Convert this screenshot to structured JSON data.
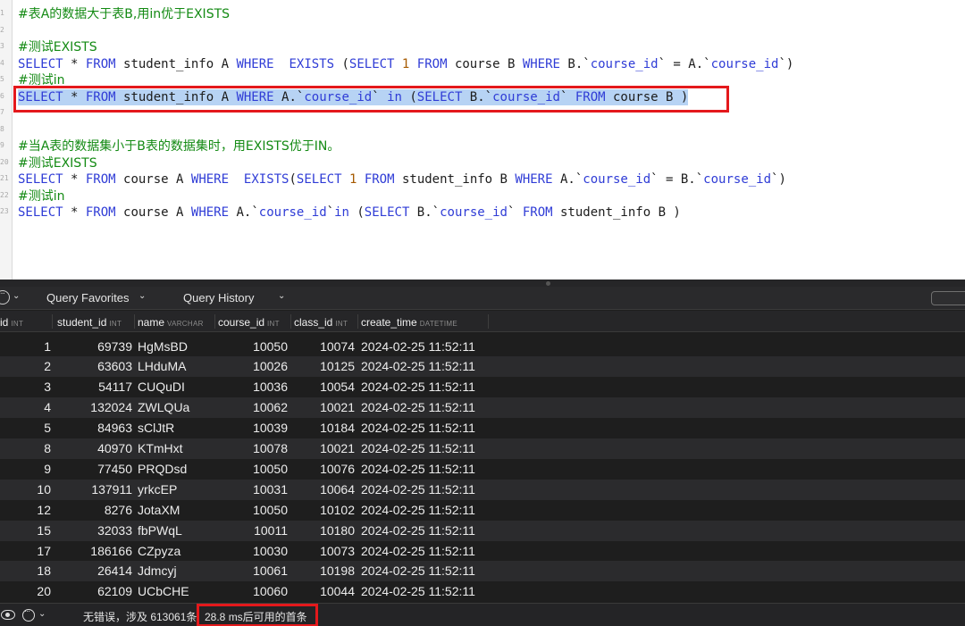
{
  "editor": {
    "lines": [
      {
        "n": "1",
        "type": "comment",
        "text": "#表A的数据大于表B,用in优于EXISTS"
      },
      {
        "n": "2",
        "type": "blank",
        "text": ""
      },
      {
        "n": "3",
        "type": "comment",
        "text": "#测试EXISTS"
      },
      {
        "n": "4",
        "type": "code",
        "tokens": [
          [
            "kw",
            "SELECT"
          ],
          [
            "t",
            " * "
          ],
          [
            "kw",
            "FROM"
          ],
          [
            "t",
            " student_info A "
          ],
          [
            "kw",
            "WHERE"
          ],
          [
            "t",
            "  "
          ],
          [
            "kw",
            "EXISTS"
          ],
          [
            "t",
            " ("
          ],
          [
            "kw",
            "SELECT"
          ],
          [
            "t",
            " "
          ],
          [
            "num",
            "1"
          ],
          [
            "t",
            " "
          ],
          [
            "kw",
            "FROM"
          ],
          [
            "t",
            " course B "
          ],
          [
            "kw",
            "WHERE"
          ],
          [
            "t",
            " B."
          ],
          [
            "tick",
            "`"
          ],
          [
            "col",
            "course_id"
          ],
          [
            "tick",
            "`"
          ],
          [
            "t",
            " = A."
          ],
          [
            "tick",
            "`"
          ],
          [
            "col",
            "course_id"
          ],
          [
            "tick",
            "`"
          ],
          [
            "t",
            ")"
          ]
        ]
      },
      {
        "n": "5",
        "type": "comment",
        "text": "#测试in"
      },
      {
        "n": "6",
        "type": "code",
        "selected": true,
        "tokens": [
          [
            "kw",
            "SELECT"
          ],
          [
            "t",
            " * "
          ],
          [
            "kw",
            "FROM"
          ],
          [
            "t",
            " student_info A "
          ],
          [
            "kw",
            "WHERE"
          ],
          [
            "t",
            " A."
          ],
          [
            "tick",
            "`"
          ],
          [
            "col",
            "course_id"
          ],
          [
            "tick",
            "`"
          ],
          [
            "t",
            " "
          ],
          [
            "kw",
            "in"
          ],
          [
            "t",
            " ("
          ],
          [
            "kw",
            "SELECT"
          ],
          [
            "t",
            " B."
          ],
          [
            "tick",
            "`"
          ],
          [
            "col",
            "course_id"
          ],
          [
            "tick",
            "`"
          ],
          [
            "t",
            " "
          ],
          [
            "kw",
            "FROM"
          ],
          [
            "t",
            " course B )"
          ]
        ]
      },
      {
        "n": "7",
        "type": "blank",
        "text": ""
      },
      {
        "n": "8",
        "type": "blank",
        "text": ""
      },
      {
        "n": "9",
        "type": "comment",
        "text": "#当A表的数据集小于B表的数据集时，用EXISTS优于IN。"
      },
      {
        "n": "20",
        "type": "comment",
        "text": "#测试EXISTS"
      },
      {
        "n": "21",
        "type": "code",
        "tokens": [
          [
            "kw",
            "SELECT"
          ],
          [
            "t",
            " * "
          ],
          [
            "kw",
            "FROM"
          ],
          [
            "t",
            " course A "
          ],
          [
            "kw",
            "WHERE"
          ],
          [
            "t",
            "  "
          ],
          [
            "kw",
            "EXISTS"
          ],
          [
            "t",
            "("
          ],
          [
            "kw",
            "SELECT"
          ],
          [
            "t",
            " "
          ],
          [
            "num",
            "1"
          ],
          [
            "t",
            " "
          ],
          [
            "kw",
            "FROM"
          ],
          [
            "t",
            " student_info B "
          ],
          [
            "kw",
            "WHERE"
          ],
          [
            "t",
            " A."
          ],
          [
            "tick",
            "`"
          ],
          [
            "col",
            "course_id"
          ],
          [
            "tick",
            "`"
          ],
          [
            "t",
            " = B."
          ],
          [
            "tick",
            "`"
          ],
          [
            "col",
            "course_id"
          ],
          [
            "tick",
            "`"
          ],
          [
            "t",
            ")"
          ]
        ]
      },
      {
        "n": "22",
        "type": "comment",
        "text": "#测试in"
      },
      {
        "n": "23",
        "type": "code",
        "tokens": [
          [
            "kw",
            "SELECT"
          ],
          [
            "t",
            " * "
          ],
          [
            "kw",
            "FROM"
          ],
          [
            "t",
            " course A "
          ],
          [
            "kw",
            "WHERE"
          ],
          [
            "t",
            " A."
          ],
          [
            "tick",
            "`"
          ],
          [
            "col",
            "course_id"
          ],
          [
            "tick",
            "`"
          ],
          [
            "kw",
            "in"
          ],
          [
            "t",
            " ("
          ],
          [
            "kw",
            "SELECT"
          ],
          [
            "t",
            " B."
          ],
          [
            "tick",
            "`"
          ],
          [
            "col",
            "course_id"
          ],
          [
            "tick",
            "`"
          ],
          [
            "t",
            " "
          ],
          [
            "kw",
            "FROM"
          ],
          [
            "t",
            " student_info B )"
          ]
        ]
      }
    ]
  },
  "toolbar": {
    "favorites_label": "Query Favorites",
    "history_label": "Query History",
    "chevron": "⌄"
  },
  "table": {
    "columns": [
      {
        "name": "id",
        "type": "INT"
      },
      {
        "name": "student_id",
        "type": "INT"
      },
      {
        "name": "name",
        "type": "VARCHAR"
      },
      {
        "name": "course_id",
        "type": "INT"
      },
      {
        "name": "class_id",
        "type": "INT"
      },
      {
        "name": "create_time",
        "type": "DATETIME"
      }
    ],
    "rows": [
      [
        "1",
        "69739",
        "HgMsBD",
        "10050",
        "10074",
        "2024-02-25 11:52:11"
      ],
      [
        "2",
        "63603",
        "LHduMA",
        "10026",
        "10125",
        "2024-02-25 11:52:11"
      ],
      [
        "3",
        "54117",
        "CUQuDI",
        "10036",
        "10054",
        "2024-02-25 11:52:11"
      ],
      [
        "4",
        "132024",
        "ZWLQUa",
        "10062",
        "10021",
        "2024-02-25 11:52:11"
      ],
      [
        "5",
        "84963",
        "sClJtR",
        "10039",
        "10184",
        "2024-02-25 11:52:11"
      ],
      [
        "8",
        "40970",
        "KTmHxt",
        "10078",
        "10021",
        "2024-02-25 11:52:11"
      ],
      [
        "9",
        "77450",
        "PRQDsd",
        "10050",
        "10076",
        "2024-02-25 11:52:11"
      ],
      [
        "10",
        "137911",
        "yrkcEP",
        "10031",
        "10064",
        "2024-02-25 11:52:11"
      ],
      [
        "12",
        "8276",
        "JotaXM",
        "10050",
        "10102",
        "2024-02-25 11:52:11"
      ],
      [
        "15",
        "32033",
        "fbPWqL",
        "10011",
        "10180",
        "2024-02-25 11:52:11"
      ],
      [
        "17",
        "186166",
        "CZpyza",
        "10030",
        "10073",
        "2024-02-25 11:52:11"
      ],
      [
        "18",
        "26414",
        "Jdmcyj",
        "10061",
        "10198",
        "2024-02-25 11:52:11"
      ],
      [
        "20",
        "62109",
        "UCbCHE",
        "10060",
        "10044",
        "2024-02-25 11:52:11"
      ]
    ]
  },
  "status": {
    "summary": "无错误，涉及 613061条",
    "timing": "28.8 ms后可用的首条",
    "chevron": "⌄"
  },
  "colors": {
    "highlight_border": "#e4191c",
    "keyword": "#2f3cd6",
    "comment": "#138a13",
    "selection": "#b7d3f4"
  }
}
